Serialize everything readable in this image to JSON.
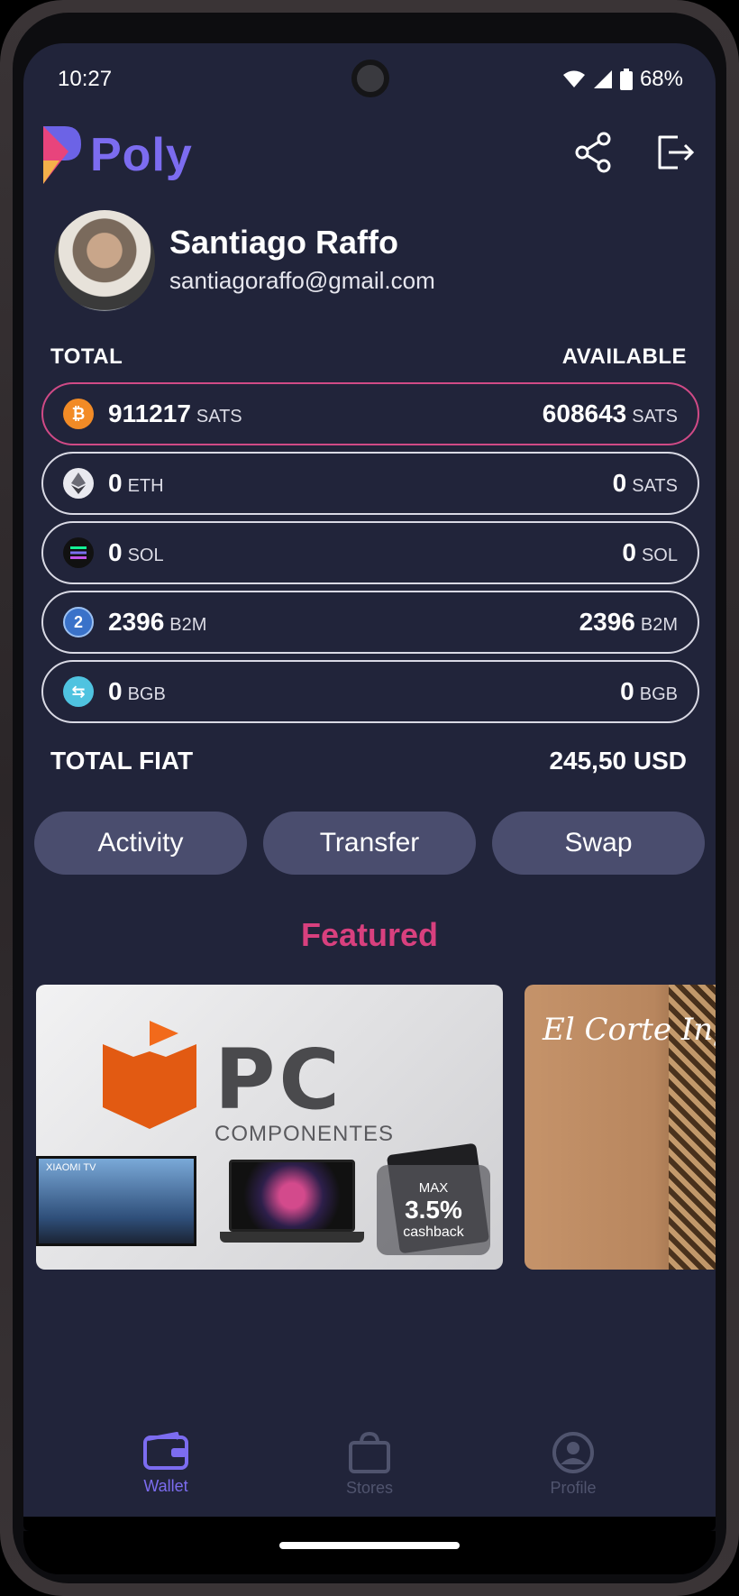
{
  "status_bar": {
    "time": "10:27",
    "battery": "68%"
  },
  "app": {
    "name": "Poly"
  },
  "header": {
    "share_icon": "share-icon",
    "logout_icon": "logout-icon"
  },
  "user": {
    "name": "Santiago Raffo",
    "email": "santiagoraffo@gmail.com"
  },
  "labels": {
    "total": "TOTAL",
    "available": "AVAILABLE",
    "total_fiat": "TOTAL FIAT"
  },
  "balances": [
    {
      "icon": "bitcoin-icon",
      "total": "911217",
      "total_unit": "SATS",
      "available": "608643",
      "available_unit": "SATS"
    },
    {
      "icon": "ethereum-icon",
      "total": "0",
      "total_unit": "ETH",
      "available": "0",
      "available_unit": "SATS"
    },
    {
      "icon": "solana-icon",
      "total": "0",
      "total_unit": "SOL",
      "available": "0",
      "available_unit": "SOL"
    },
    {
      "icon": "b2m-icon",
      "total": "2396",
      "total_unit": "B2M",
      "available": "2396",
      "available_unit": "B2M"
    },
    {
      "icon": "bgb-icon",
      "total": "0",
      "total_unit": "BGB",
      "available": "0",
      "available_unit": "BGB"
    }
  ],
  "total_fiat": "245,50 USD",
  "actions": {
    "activity": "Activity",
    "transfer": "Transfer",
    "swap": "Swap"
  },
  "featured": {
    "title": "Featured",
    "cards": [
      {
        "brand_main": "PC",
        "brand_sub": "COMPONENTES",
        "tv_label": "XIAOMI TV",
        "cashback_max": "MAX",
        "cashback_value": "3.5%",
        "cashback_label": "cashback"
      },
      {
        "brand": "El Corte Inglés"
      }
    ]
  },
  "nav": {
    "wallet": "Wallet",
    "stores": "Stores",
    "profile": "Profile"
  },
  "colors": {
    "background": "#21243a",
    "accent": "#7c6cf0",
    "featured": "#d8407e",
    "button": "#4a4d6e",
    "active_border": "#d04a86"
  }
}
